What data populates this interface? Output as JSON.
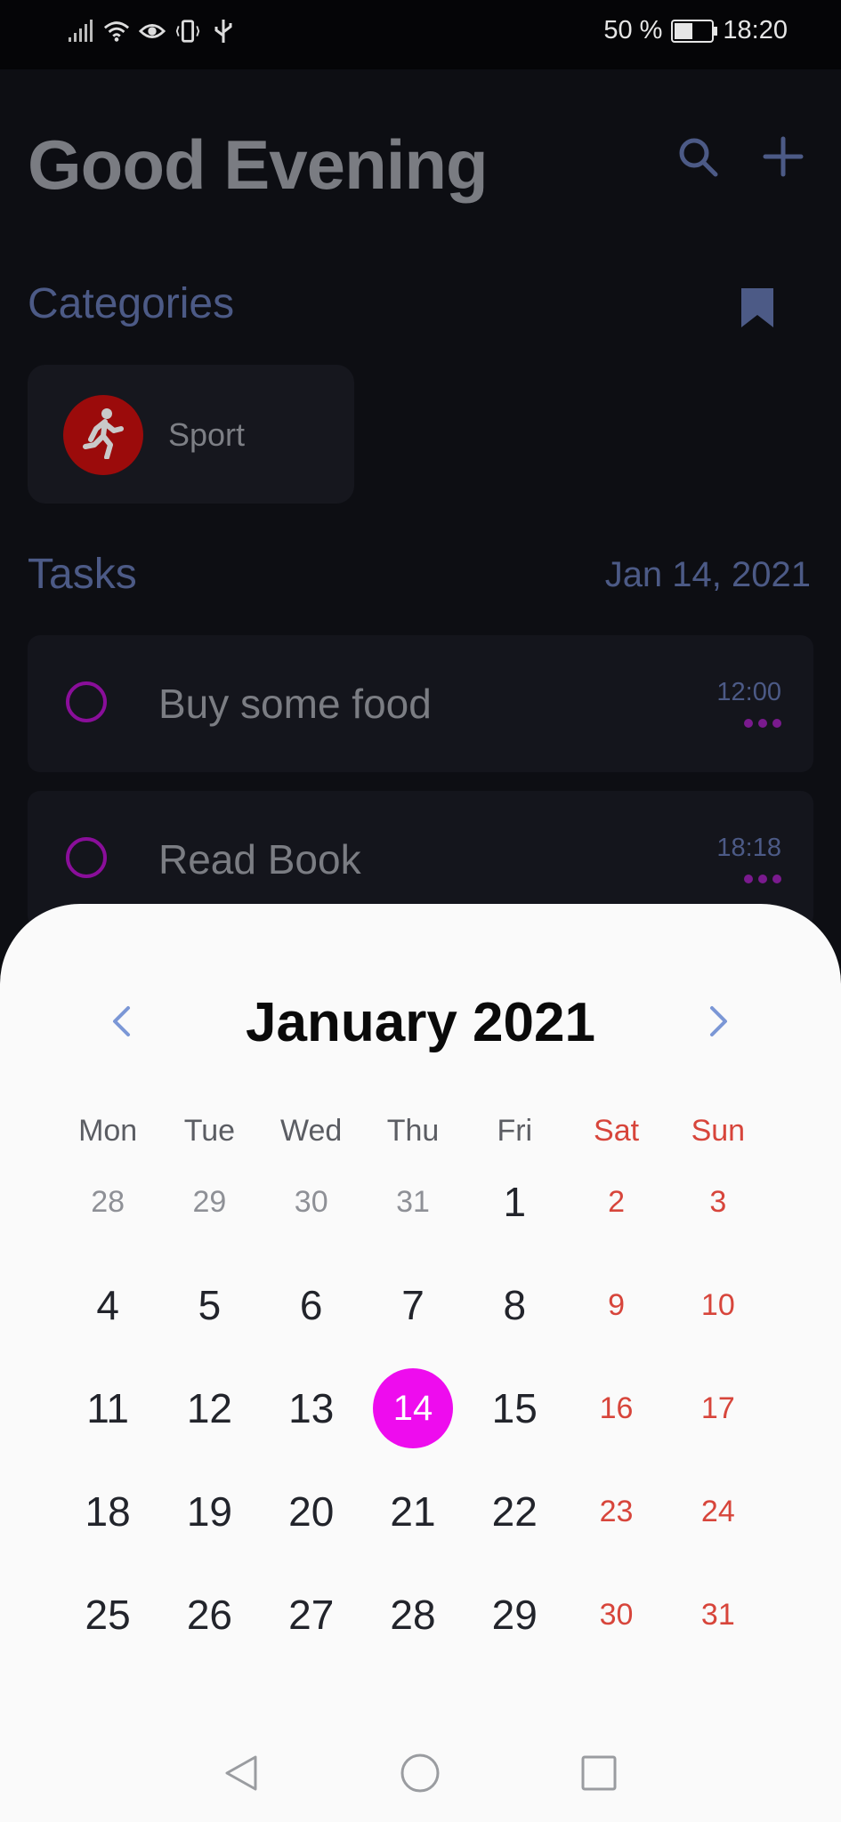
{
  "status_bar": {
    "battery": "50 %",
    "battery_level": 0.5,
    "time": "18:20",
    "icons": [
      "signal-icon",
      "wifi-icon",
      "eye-icon",
      "vibrate-icon",
      "usb-icon",
      "battery-icon"
    ]
  },
  "header": {
    "greeting": "Good Evening",
    "search_icon": "search-icon",
    "add_icon": "plus-icon"
  },
  "categories": {
    "title": "Categories",
    "bookmark_icon": "bookmark-icon",
    "items": [
      {
        "label": "Sport",
        "icon": "running-person-icon",
        "color": "#9b0b0b"
      }
    ]
  },
  "tasks": {
    "title": "Tasks",
    "date": "Jan 14, 2021",
    "items": [
      {
        "title": "Buy some food",
        "time": "12:00"
      },
      {
        "title": "Read Book",
        "time": "18:18"
      }
    ]
  },
  "calendar": {
    "month_title": "January 2021",
    "prev_icon": "chevron-left-icon",
    "next_icon": "chevron-right-icon",
    "weekdays": [
      "Mon",
      "Tue",
      "Wed",
      "Thu",
      "Fri",
      "Sat",
      "Sun"
    ],
    "weeks": [
      [
        "28",
        "29",
        "30",
        "31",
        "1",
        "2",
        "3"
      ],
      [
        "4",
        "5",
        "6",
        "7",
        "8",
        "9",
        "10"
      ],
      [
        "11",
        "12",
        "13",
        "14",
        "15",
        "16",
        "17"
      ],
      [
        "18",
        "19",
        "20",
        "21",
        "22",
        "23",
        "24"
      ],
      [
        "25",
        "26",
        "27",
        "28",
        "29",
        "30",
        "31"
      ]
    ],
    "selected_day": "14",
    "accent_color": "#ee0cee",
    "weekend_color": "#d7453b"
  },
  "nav_bar": {
    "back_icon": "back-triangle-icon",
    "home_icon": "home-circle-icon",
    "recents_icon": "recents-square-icon"
  }
}
